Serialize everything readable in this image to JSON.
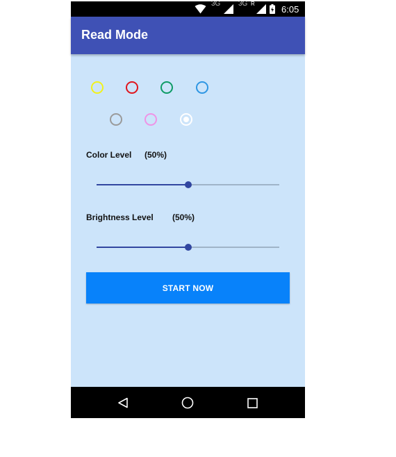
{
  "status_bar": {
    "network_1": "3G",
    "network_2": "3G",
    "roaming": "R",
    "time": "6:05",
    "icons": [
      "wifi-icon",
      "signal-icon",
      "signal-icon",
      "battery-icon"
    ]
  },
  "app_bar": {
    "title": "Read Mode"
  },
  "color_options": [
    {
      "name": "yellow",
      "color": "#f2f21a",
      "selected": false
    },
    {
      "name": "red",
      "color": "#e0151d",
      "selected": false
    },
    {
      "name": "green",
      "color": "#0e9b66",
      "selected": false
    },
    {
      "name": "blue",
      "color": "#2e96e3",
      "selected": false
    },
    {
      "name": "gray",
      "color": "#9a9a9a",
      "selected": false
    },
    {
      "name": "pink",
      "color": "#ef93e6",
      "selected": false
    },
    {
      "name": "white",
      "color": "#ffffff",
      "selected": true
    }
  ],
  "color_level": {
    "label": "Color Level",
    "value_text": "(50%)",
    "value": 0.5
  },
  "brightness_level": {
    "label": "Brightness Level",
    "value_text": "(50%)",
    "value": 0.5
  },
  "start_button": {
    "label": "START NOW"
  },
  "nav_bar": {
    "icons": [
      "back-icon",
      "home-icon",
      "recents-icon"
    ]
  },
  "colors": {
    "app_bar": "#3f51b5",
    "background": "#cce4fa",
    "accent": "#3146a0",
    "button": "#0882fa"
  }
}
